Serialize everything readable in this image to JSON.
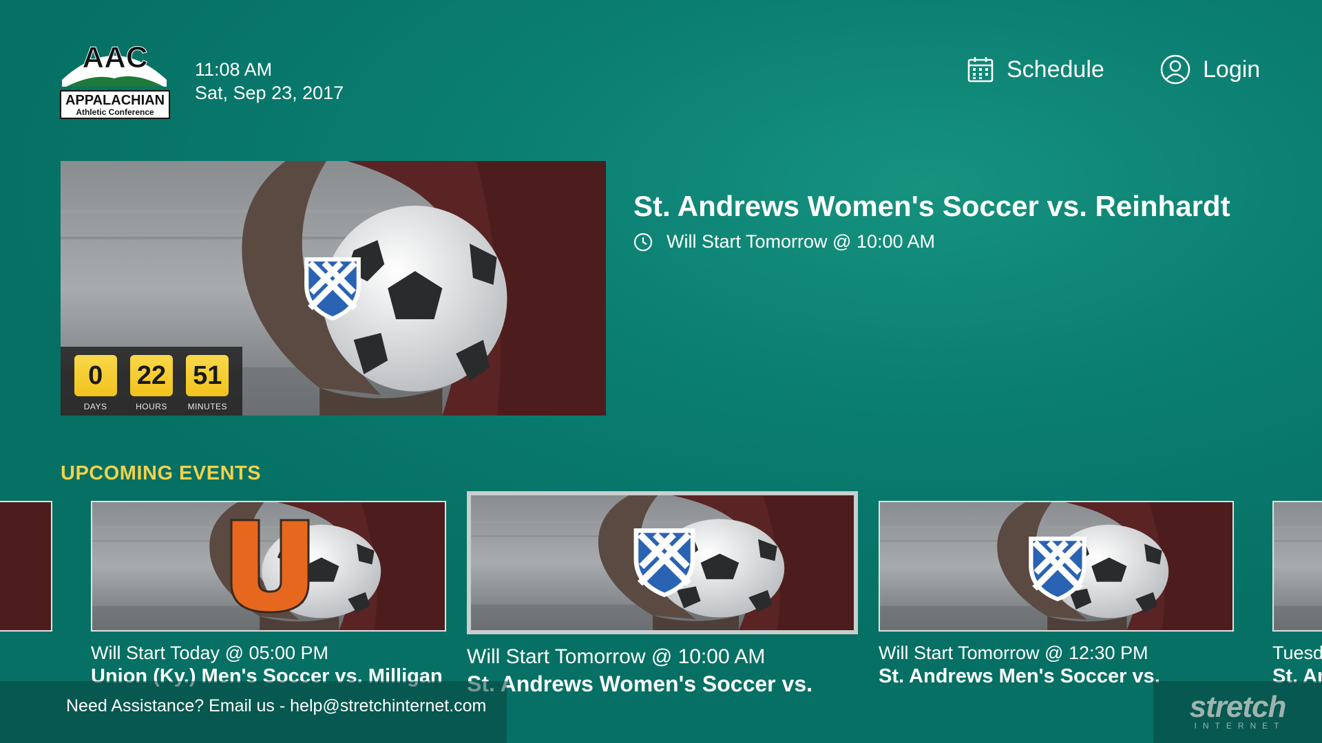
{
  "header": {
    "logo": {
      "big": "AAC",
      "line1": "APPALACHIAN",
      "line2": "Athletic Conference"
    },
    "time": "11:08 AM",
    "date": "Sat, Sep 23, 2017",
    "nav": {
      "schedule": "Schedule",
      "login": "Login"
    }
  },
  "featured": {
    "title": "St. Andrews Women's Soccer vs. Reinhardt",
    "start": "Will Start Tomorrow @ 10:00 AM",
    "team_logo": "knights-shield",
    "countdown": [
      {
        "value": "0",
        "label": "DAYS"
      },
      {
        "value": "22",
        "label": "HOURS"
      },
      {
        "value": "51",
        "label": "MINUTES"
      }
    ]
  },
  "upcoming": {
    "title": "UPCOMING EVENTS",
    "events": [
      {
        "line1": "",
        "line2": "",
        "team_logo": "none"
      },
      {
        "line1": "Will Start Today @ 05:00 PM",
        "line2": "Union (Ky.) Men's Soccer vs. Milligan",
        "team_logo": "union-u"
      },
      {
        "line1": "Will Start Tomorrow @ 10:00 AM",
        "line2": "St. Andrews Women's Soccer vs.",
        "team_logo": "knights-shield"
      },
      {
        "line1": "Will Start Tomorrow @ 12:30 PM",
        "line2": "St. Andrews Men's Soccer vs.",
        "team_logo": "knights-shield"
      },
      {
        "line1": "Tuesd",
        "line2": "St. An",
        "team_logo": "none"
      }
    ]
  },
  "footer": {
    "help": "Need Assistance? Email us - help@stretchinternet.com",
    "brand": "stretch",
    "brand_sub": "INTERNET"
  },
  "colors": {
    "accent": "#f2d14b",
    "countdown": "#f2c21d",
    "union_orange": "#e8671f",
    "shield_blue": "#2a63b4"
  }
}
